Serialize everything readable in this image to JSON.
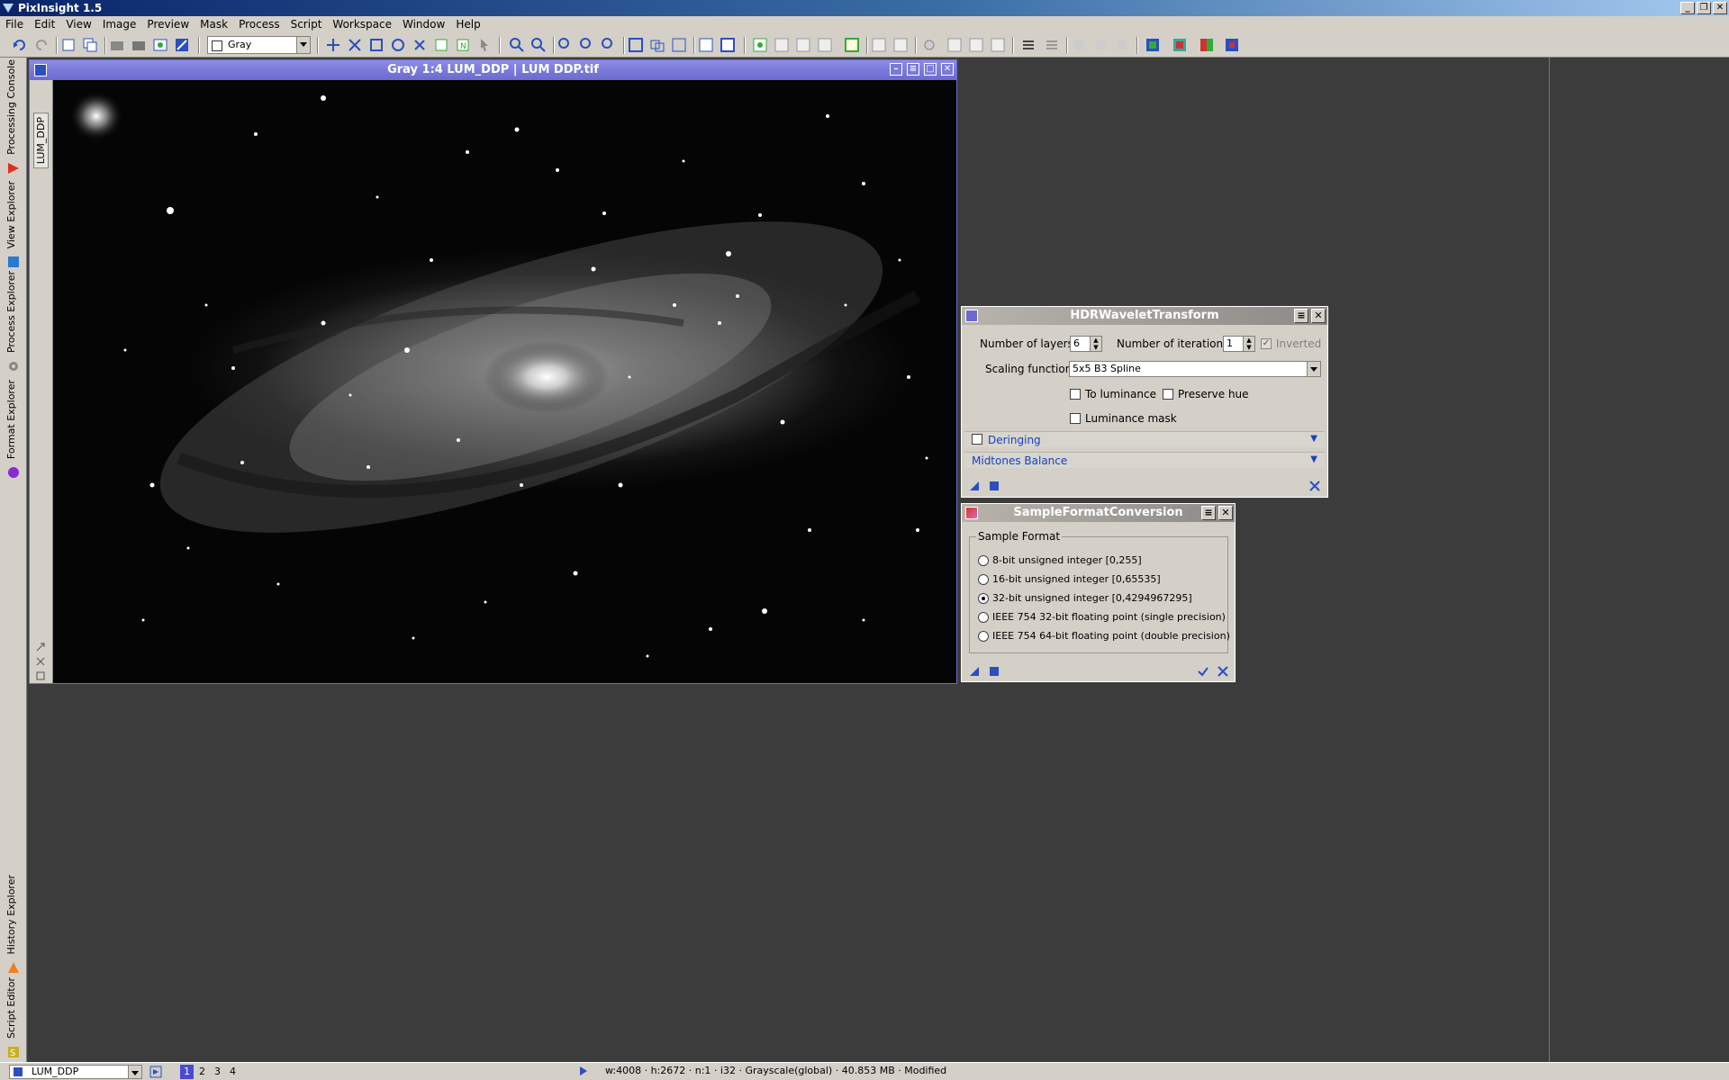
{
  "app": {
    "title": "PixInsight 1.5"
  },
  "menu": [
    "File",
    "Edit",
    "View",
    "Image",
    "Preview",
    "Mask",
    "Process",
    "Script",
    "Workspace",
    "Window",
    "Help"
  ],
  "toolbar": {
    "view_select": "Gray"
  },
  "sidebar": {
    "tabs": [
      "Processing Console",
      "View Explorer",
      "Process Explorer",
      "Format Explorer",
      "History Explorer",
      "Script Editor"
    ]
  },
  "image_window": {
    "title": "Gray 1:4 LUM_DDP | LUM DDP.tif",
    "vertical_tab": "LUM_DDP"
  },
  "hdr": {
    "title": "HDRWaveletTransform",
    "layers_label": "Number of layers:",
    "layers_value": "6",
    "iterations_label": "Number of iterations:",
    "iterations_value": "1",
    "inverted_label": "Inverted",
    "scaling_label": "Scaling function:",
    "scaling_value": "5x5 B3 Spline",
    "to_luminance": "To luminance",
    "preserve_hue": "Preserve hue",
    "luminance_mask": "Luminance mask",
    "deringing": "Deringing",
    "midtones": "Midtones Balance"
  },
  "sfc": {
    "title": "SampleFormatConversion",
    "group_label": "Sample Format",
    "options": [
      "8-bit unsigned integer [0,255]",
      "16-bit unsigned integer [0,65535]",
      "32-bit unsigned integer [0,4294967295]",
      "IEEE 754 32-bit floating point (single precision)",
      "IEEE 754 64-bit floating point (double precision)"
    ],
    "selected_index": 2
  },
  "status": {
    "view": "LUM_DDP",
    "workspaces": [
      "1",
      "2",
      "3",
      "4"
    ],
    "active_workspace": "1",
    "info": "w:4008 · h:2672 · n:1 · i32 · Grayscale(global) · 40.853 MB · Modified"
  },
  "colors": {
    "titlebar": "#0a246a",
    "accent": "#1740c8",
    "desktop": "#3c3c3c"
  }
}
